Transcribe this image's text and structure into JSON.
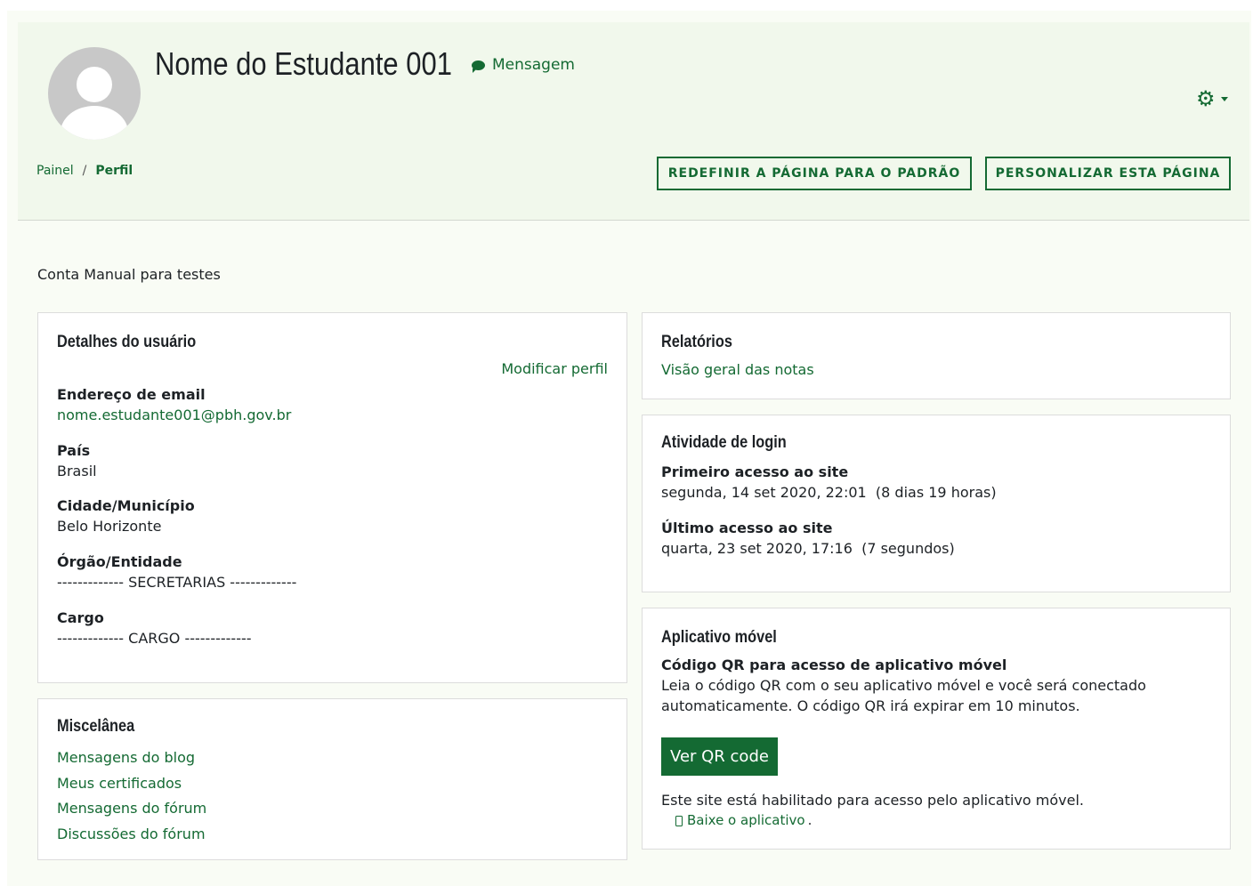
{
  "header": {
    "user_name": "Nome do Estudante 001",
    "message_label": "Mensagem",
    "gear_icon": "gear-icon",
    "breadcrumb": {
      "home": "Painel",
      "separator": "/",
      "current": "Perfil"
    },
    "reset_button": "REDEFINIR A PÁGINA PARA O PADRÃO",
    "customize_button": "PERSONALIZAR ESTA PÁGINA"
  },
  "account_description": "Conta Manual para testes",
  "user_details": {
    "title": "Detalhes do usuário",
    "edit_link": "Modificar perfil",
    "email_label": "Endereço de email",
    "email_value": "nome.estudante001@pbh.gov.br",
    "country_label": "País",
    "country_value": "Brasil",
    "city_label": "Cidade/Município",
    "city_value": "Belo Horizonte",
    "org_label": "Órgão/Entidade",
    "org_value": "------------- SECRETARIAS -------------",
    "role_label": "Cargo",
    "role_value": "------------- CARGO -------------"
  },
  "misc": {
    "title": "Miscelânea",
    "links": [
      "Mensagens do blog",
      "Meus certificados",
      "Mensagens do fórum",
      "Discussões do fórum"
    ]
  },
  "reports": {
    "title": "Relatórios",
    "link": "Visão geral das notas"
  },
  "login_activity": {
    "title": "Atividade de login",
    "first_label": "Primeiro acesso ao site",
    "first_value": "segunda, 14 set 2020, 22:01  (8 dias 19 horas)",
    "last_label": "Último acesso ao site",
    "last_value": "quarta, 23 set 2020, 17:16  (7 segundos)"
  },
  "mobile_app": {
    "title": "Aplicativo móvel",
    "qr_heading": "Código QR para acesso de aplicativo móvel",
    "qr_text": "Leia o código QR com o seu aplicativo móvel e você será conectado automaticamente. O código QR irá expirar em 10 minutos.",
    "qr_button": "Ver QR code",
    "enabled_text": "Este site está habilitado para acesso pelo aplicativo móvel.",
    "download_link": "Baixe o aplicativo",
    "download_suffix": "."
  },
  "colors": {
    "brand_green": "#146a33",
    "header_bg": "#f1f8ec"
  }
}
